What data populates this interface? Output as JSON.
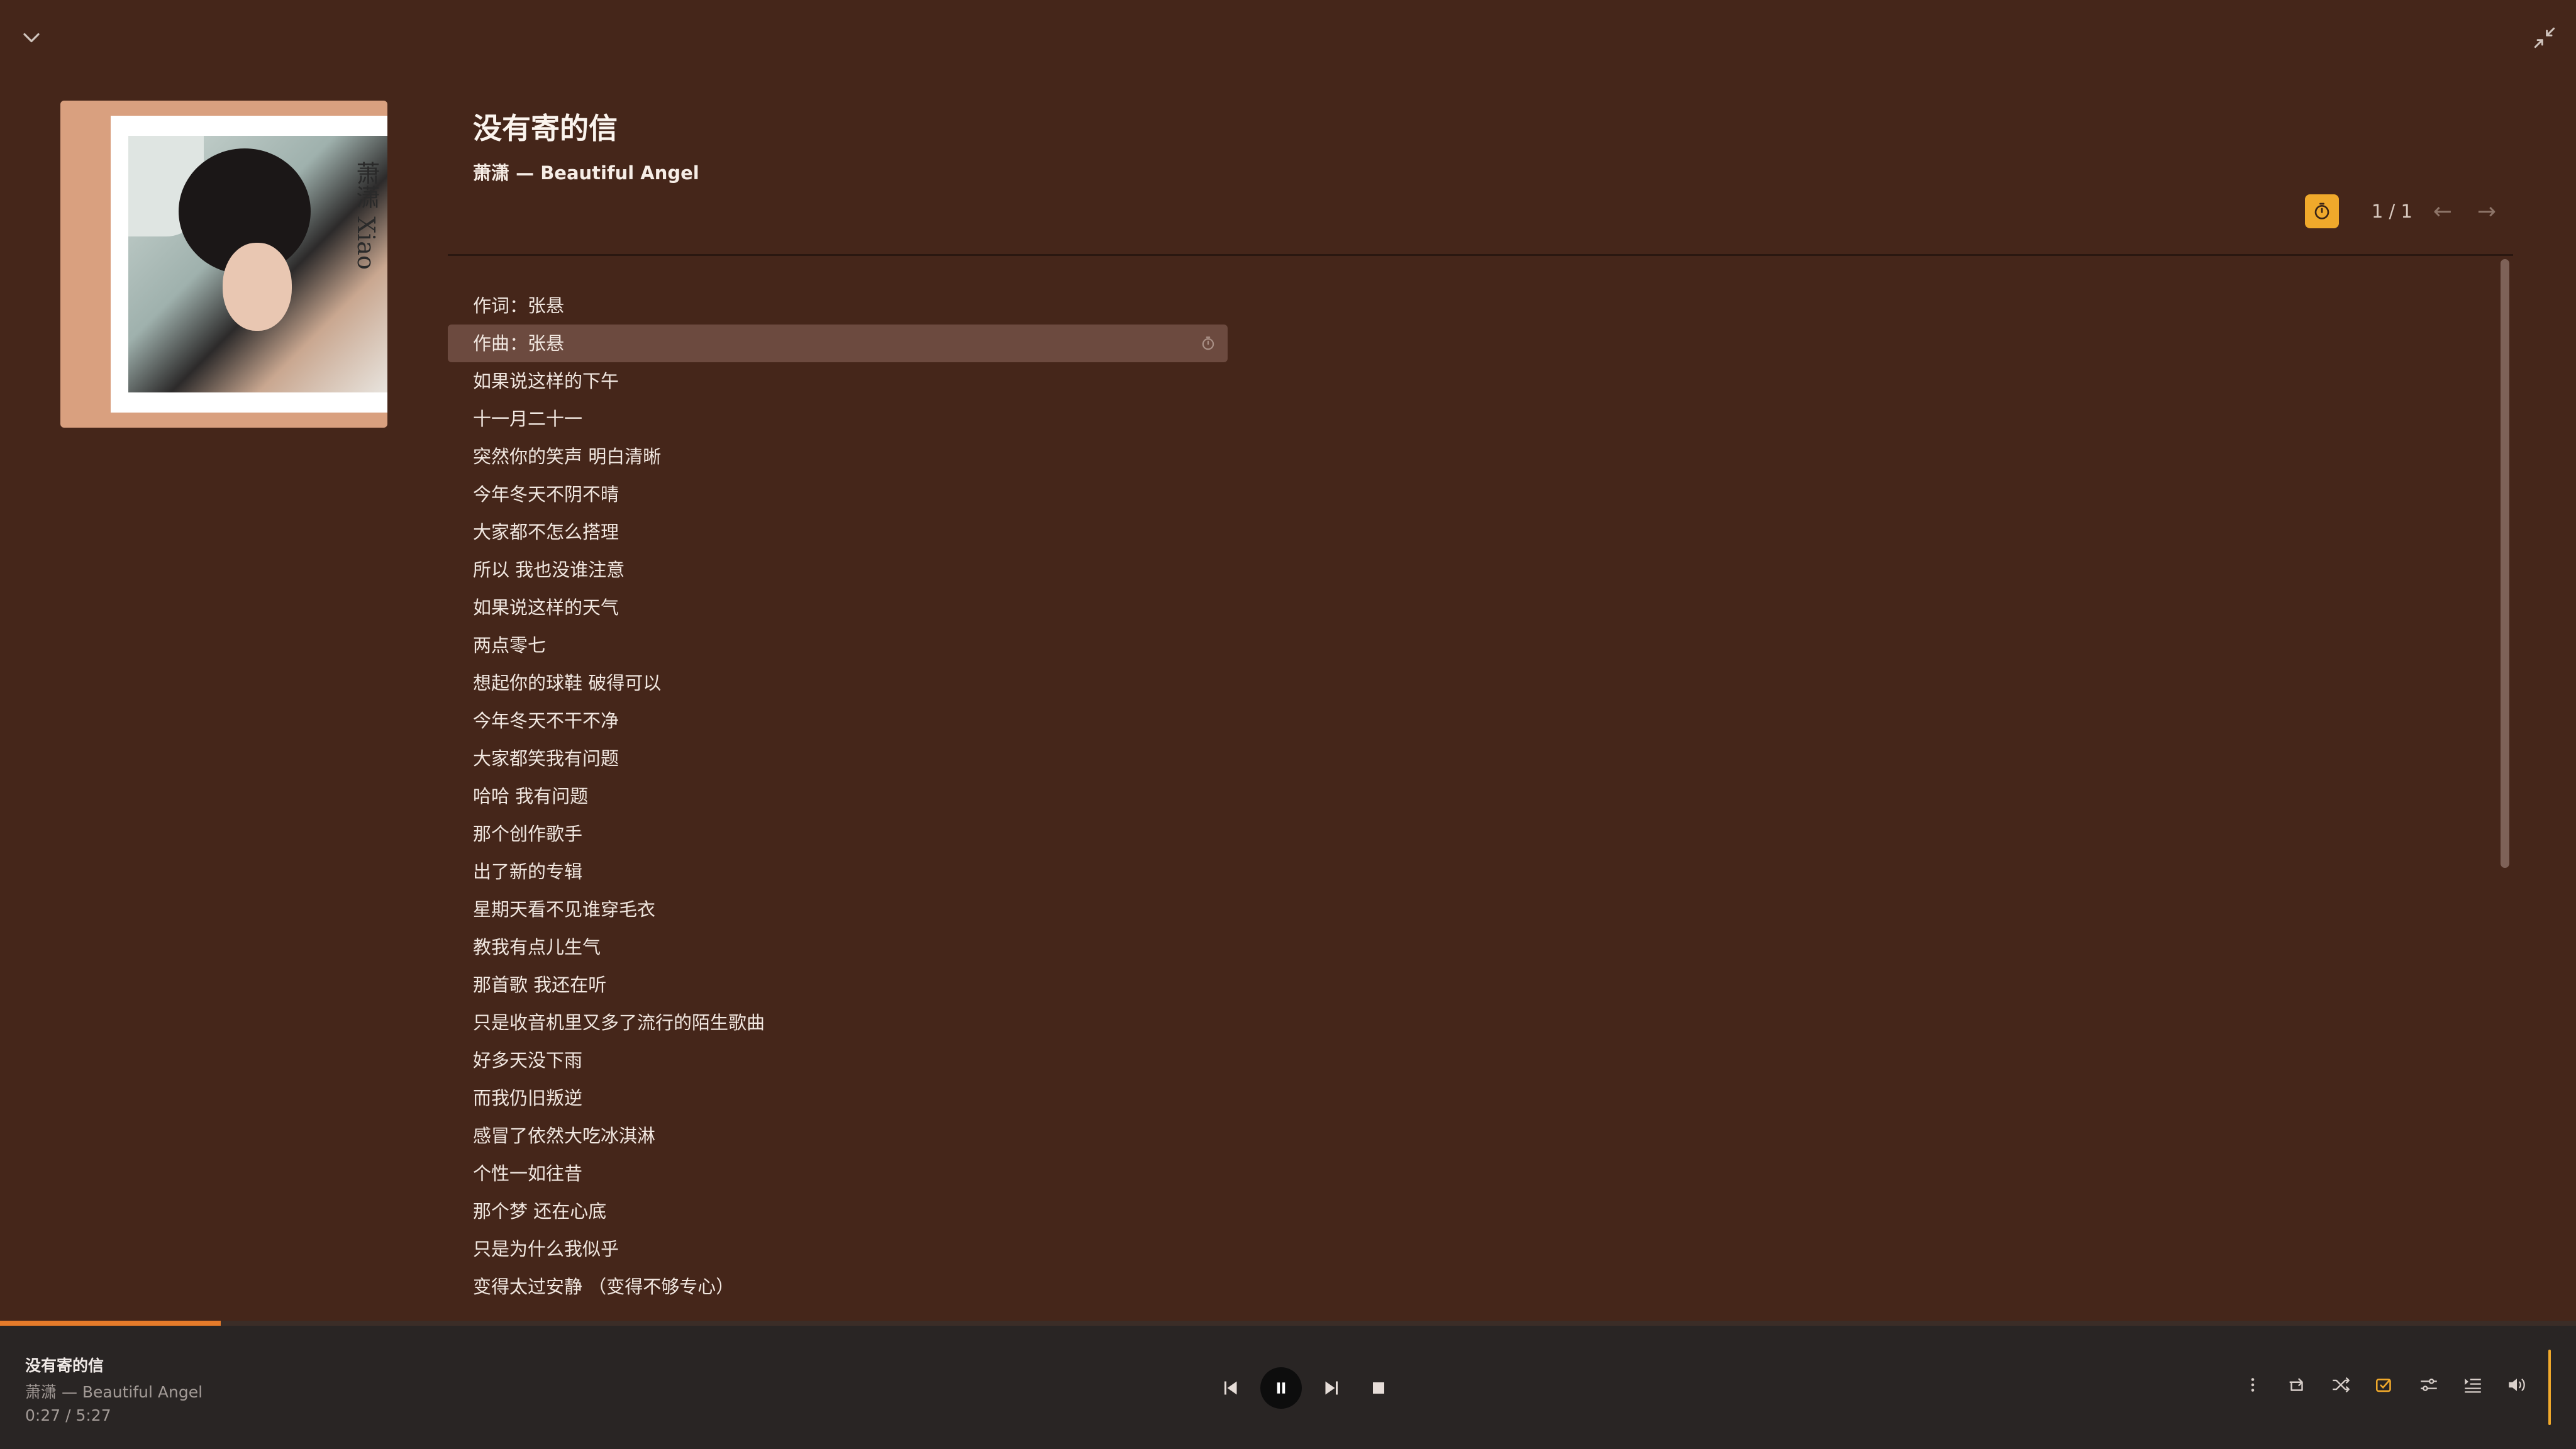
{
  "window": {
    "collapse_icon": "chevron-down-icon",
    "exit_fullscreen_icon": "exit-fullscreen-icon"
  },
  "track": {
    "title": "没有寄的信",
    "subtitle": "萧潇 — Beautiful Angel",
    "cover_text": "萧潇 Xiao"
  },
  "lyrics_nav": {
    "count": "1 / 1",
    "prev": "←",
    "next": "→",
    "sync_color": "#f0a92b"
  },
  "lyrics": {
    "active_index": 1,
    "lines": [
      "作词：张悬",
      "作曲：张悬",
      "如果说这样的下午",
      "十一月二十一",
      "突然你的笑声 明白清晰",
      "今年冬天不阴不晴",
      "大家都不怎么搭理",
      "所以 我也没谁注意",
      "如果说这样的天气",
      "两点零七",
      "想起你的球鞋 破得可以",
      "今年冬天不干不净",
      "大家都笑我有问题",
      "哈哈 我有问题",
      "那个创作歌手",
      "出了新的专辑",
      "星期天看不见谁穿毛衣",
      "教我有点儿生气",
      "那首歌 我还在听",
      "只是收音机里又多了流行的陌生歌曲",
      "好多天没下雨",
      "而我仍旧叛逆",
      "感冒了依然大吃冰淇淋",
      "个性一如往昔",
      "那个梦 还在心底",
      "只是为什么我似乎",
      "变得太过安静 （变得不够专心）"
    ]
  },
  "player": {
    "title": "没有寄的信",
    "artist": "萧潇 — Beautiful Angel",
    "time": "0:27 / 5:27",
    "progress": 0.0856,
    "accent": "#f0a92b",
    "progress_color": "#e57b2a"
  }
}
